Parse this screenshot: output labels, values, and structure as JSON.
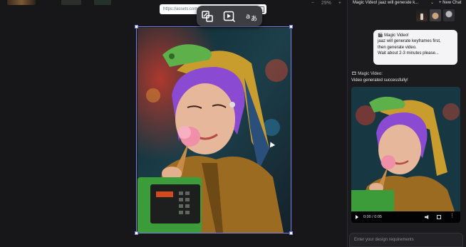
{
  "canvas": {
    "zoom_minus": "−",
    "zoom_level": "29%",
    "zoom_plus": "+",
    "url_text": "https://assets.com/",
    "toolbar_icons": [
      "crop-resize-icon",
      "video-generate-icon",
      "translate-icon"
    ]
  },
  "chat": {
    "title": "Magic Video! jaaz will generate k...",
    "new_chat_label": "+ New Chat",
    "user_message": {
      "line1": "Magic Video!",
      "line2": "jaaz will generate keyframes first,",
      "line3": "then generate video.",
      "line4": "Wait about 2-3 minutes please..."
    },
    "assistant_name": "Magic Video:",
    "assistant_text": "Video generated successfully!",
    "video_time": "0:00 / 0:05",
    "input_placeholder": "Enter your design requirements"
  },
  "colors": {
    "selection": "#7a7fe8",
    "background": "#1b1b1d",
    "bubble": "#f4f4f6"
  }
}
